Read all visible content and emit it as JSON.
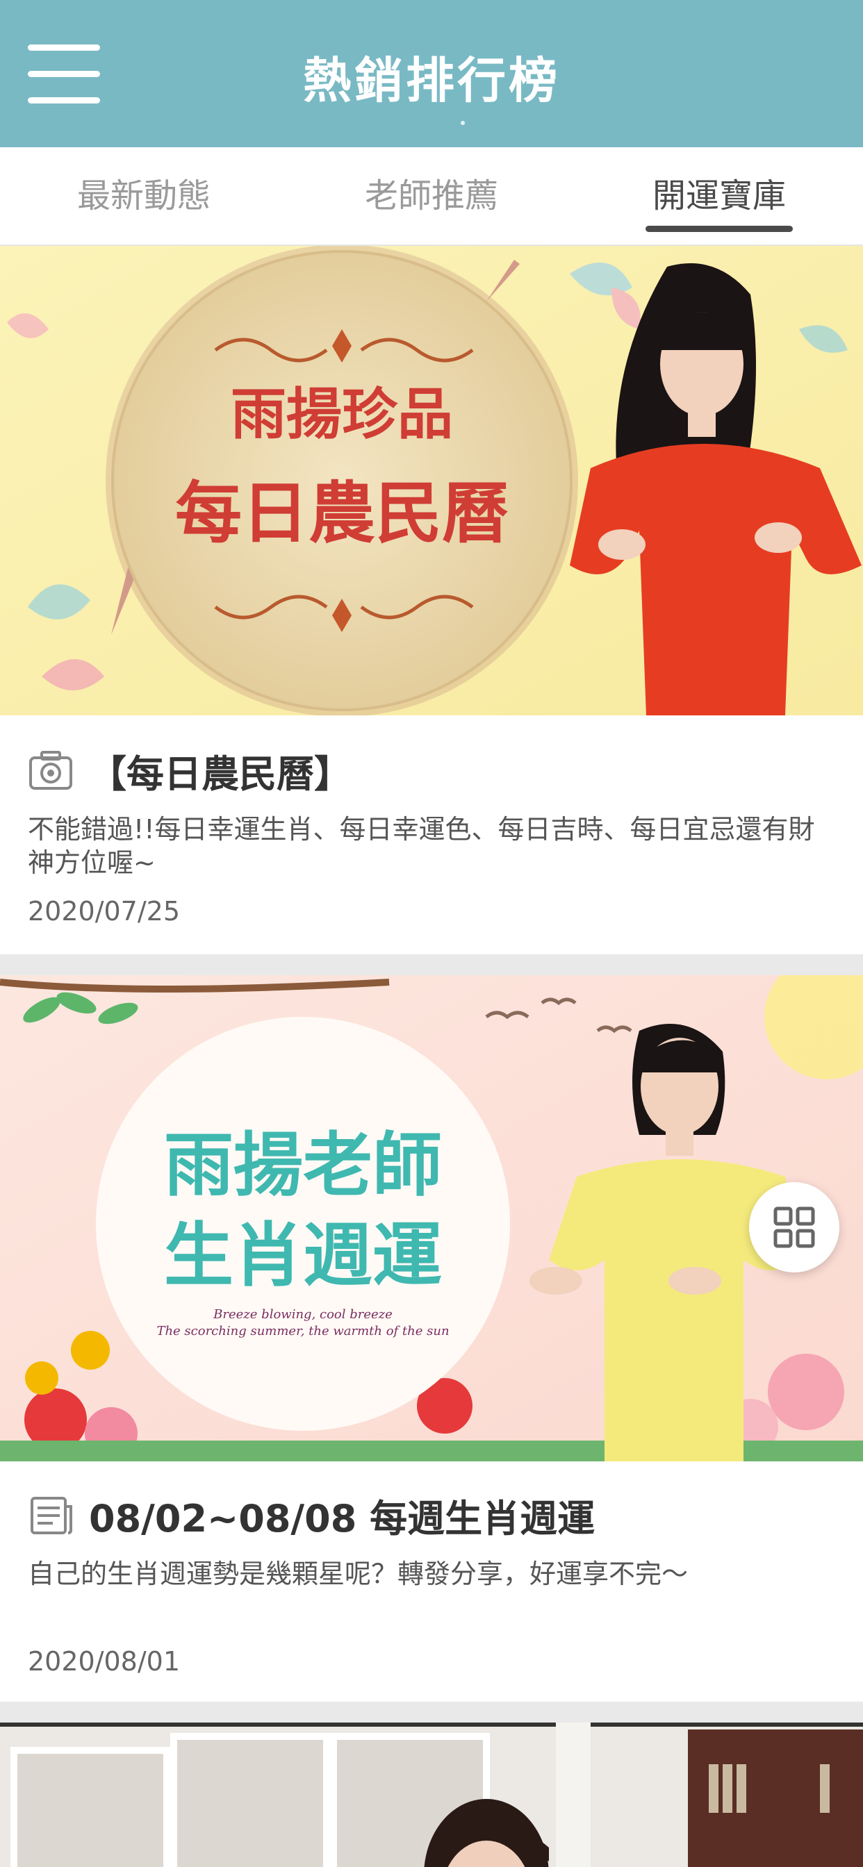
{
  "header": {
    "title": "熱銷排行榜",
    "menu_icon": "hamburger-menu-icon"
  },
  "tabs": [
    {
      "label": "最新動態",
      "active": false
    },
    {
      "label": "老師推薦",
      "active": false
    },
    {
      "label": "開運寶庫",
      "active": true
    }
  ],
  "cards": [
    {
      "banner": {
        "circle_line1": "雨揚珍品",
        "circle_line2": "每日農民曆"
      },
      "icon": "camera-icon",
      "title": "【每日農民曆】",
      "description": "不能錯過!!每日幸運生肖、每日幸運色、每日吉時、每日宜忌還有財神方位喔~",
      "date": "2020/07/25"
    },
    {
      "banner": {
        "circle_line1": "雨揚老師",
        "circle_line2": "生肖週運",
        "tagline1": "Breeze blowing, cool breeze",
        "tagline2": "The scorching summer, the warmth of the sun"
      },
      "icon": "article-icon",
      "title": "08/02~08/08 每週生肖週運",
      "description": "自己的生肖週運勢是幾顆星呢？轉發分享，好運享不完～",
      "date": "2020/08/01"
    }
  ],
  "floating_button": {
    "icon": "grid-icon"
  },
  "colors": {
    "header_bg": "#79b9c4",
    "accent_red": "#d9413a",
    "accent_teal": "#3fb8b0"
  }
}
